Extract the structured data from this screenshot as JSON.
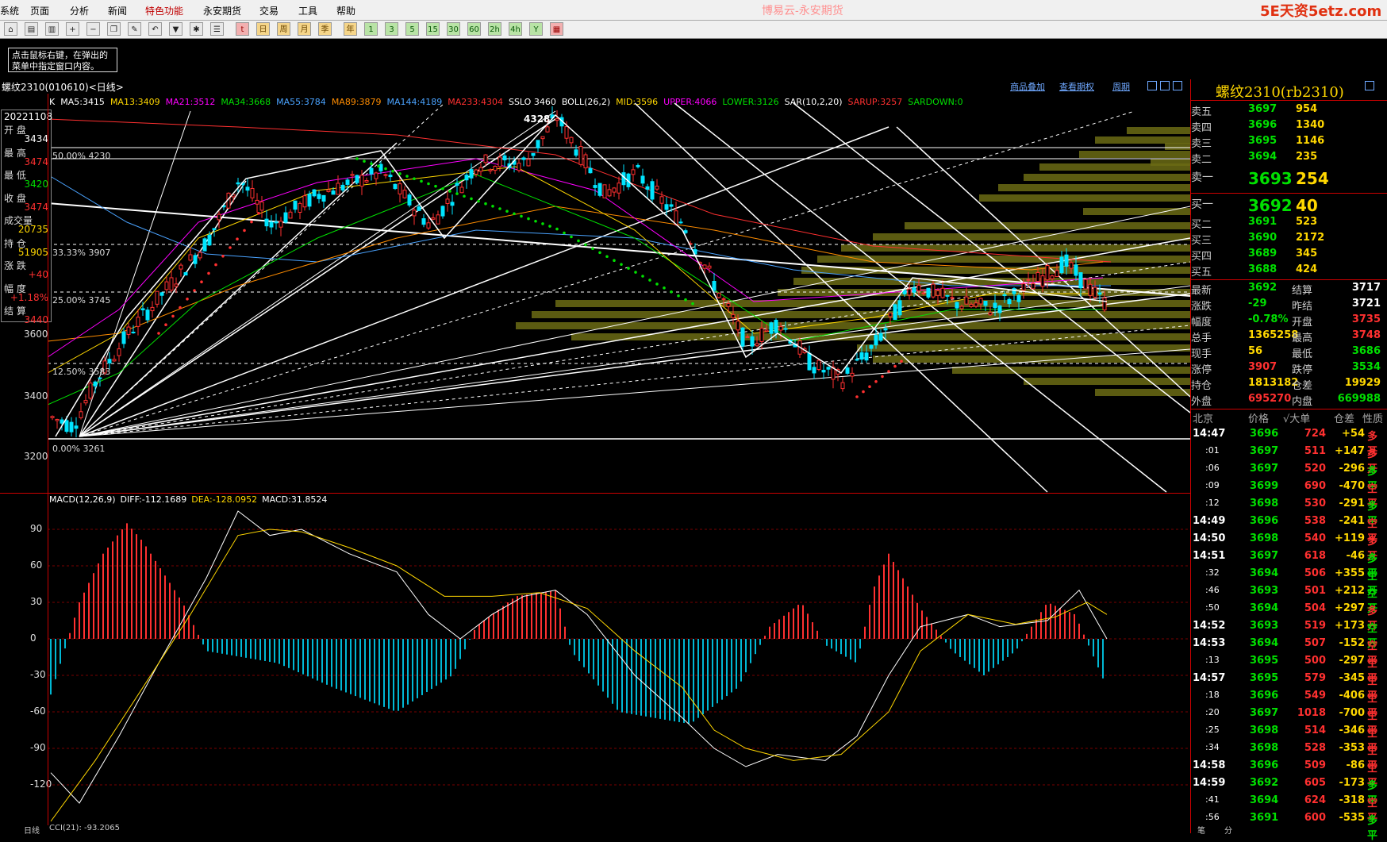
{
  "menu": {
    "items": [
      "系统",
      "页面",
      "分析",
      "新闻",
      "特色功能",
      "永安期货",
      "交易",
      "工具",
      "帮助"
    ],
    "active_index": 4,
    "app_title": "博易云-永安期货",
    "watermark": "5E天资5etz.com"
  },
  "toolbar": {
    "buttons": [
      "home",
      "news",
      "chart",
      "zoom-in",
      "zoom-out",
      "copy",
      "draw",
      "undo",
      "filter",
      "new",
      "list",
      "tick",
      "day",
      "week",
      "month",
      "season",
      "year",
      "1",
      "3",
      "5",
      "15",
      "30",
      "60",
      "2h",
      "4h",
      "Y",
      "table"
    ]
  },
  "hint": {
    "line1": "点击鼠标右键，在弹出的",
    "line2": "菜单中指定窗口内容。"
  },
  "chart_header": {
    "title": "螺纹2310(010610)<日线>",
    "links": [
      "商品叠加",
      "查看期权",
      "周期"
    ]
  },
  "indicators": [
    {
      "text": "K",
      "color": "#ffffff"
    },
    {
      "text": "MA5:3415",
      "color": "#ffffff"
    },
    {
      "text": "MA13:3409",
      "color": "#ffd700"
    },
    {
      "text": "MA21:3512",
      "color": "#ff00ff"
    },
    {
      "text": "MA34:3668",
      "color": "#00e000"
    },
    {
      "text": "MA55:3784",
      "color": "#4aa3ff"
    },
    {
      "text": "MA89:3879",
      "color": "#ff8c00"
    },
    {
      "text": "MA144:4189",
      "color": "#4aa3ff"
    },
    {
      "text": "MA233:4304",
      "color": "#ff3030"
    },
    {
      "text": "SSLO 3460",
      "color": "#ffffff"
    },
    {
      "text": "BOLL(26,2)",
      "color": "#ffffff"
    },
    {
      "text": "MID:3596",
      "color": "#ffd700"
    },
    {
      "text": "UPPER:4066",
      "color": "#ff00ff"
    },
    {
      "text": "LOWER:3126",
      "color": "#00e000"
    },
    {
      "text": "SAR(10,2,20)",
      "color": "#ffffff"
    },
    {
      "text": "SARUP:3257",
      "color": "#ff3030"
    },
    {
      "text": "SARDOWN:0",
      "color": "#00e000"
    }
  ],
  "ohlc_box": {
    "date": "20221108",
    "rows": [
      {
        "label": "开  盘",
        "value": "3434",
        "color": "#ffffff"
      },
      {
        "label": "最  高",
        "value": "3474",
        "color": "#ff3030"
      },
      {
        "label": "最  低",
        "value": "3420",
        "color": "#00e000"
      },
      {
        "label": "收  盘",
        "value": "3474",
        "color": "#ff3030"
      },
      {
        "label": "成交量",
        "value": "20735",
        "color": "#ffd700"
      },
      {
        "label": "持  仓",
        "value": "51905",
        "color": "#ffd700"
      },
      {
        "label": "涨  跌",
        "value": "+40",
        "color": "#ff3030"
      },
      {
        "label": "幅  度",
        "value": "+1.18%",
        "color": "#ff3030"
      },
      {
        "label": "结  算",
        "value": "3440",
        "color": "#ff3030"
      }
    ]
  },
  "price_axis": [
    "3600",
    "3400",
    "3200"
  ],
  "fib_labels": [
    {
      "text": "50.00% 4230"
    },
    {
      "text": "33.33% 3907"
    },
    {
      "text": "25.00% 3745"
    },
    {
      "text": "12.50% 3583"
    },
    {
      "text": "0.00% 3261"
    }
  ],
  "high_marker": "4328",
  "macd": {
    "header": [
      {
        "text": "MACD(12,26,9)",
        "color": "#ffffff"
      },
      {
        "text": "DIFF:-112.1689",
        "color": "#ffffff"
      },
      {
        "text": "DEA:-128.0952",
        "color": "#ffd700"
      },
      {
        "text": "MACD:31.8524",
        "color": "#ffffff"
      }
    ],
    "axis": [
      "90",
      "60",
      "30",
      "0",
      "-30",
      "-60",
      "-90",
      "-120"
    ]
  },
  "footer": {
    "left": "日线",
    "cci": "CCI(21): -93.2065"
  },
  "quote": {
    "title": "螺纹2310(rb2310)",
    "asks": [
      {
        "label": "卖五",
        "price": "3697",
        "vol": "954"
      },
      {
        "label": "卖四",
        "price": "3696",
        "vol": "1340"
      },
      {
        "label": "卖三",
        "price": "3695",
        "vol": "1146"
      },
      {
        "label": "卖二",
        "price": "3694",
        "vol": "235"
      },
      {
        "label": "卖一",
        "price": "3693",
        "vol": "254"
      }
    ],
    "bids": [
      {
        "label": "买一",
        "price": "3692",
        "vol": "40"
      },
      {
        "label": "买二",
        "price": "3691",
        "vol": "523"
      },
      {
        "label": "买三",
        "price": "3690",
        "vol": "2172"
      },
      {
        "label": "买四",
        "price": "3689",
        "vol": "345"
      },
      {
        "label": "买五",
        "price": "3688",
        "vol": "424"
      }
    ],
    "stats": [
      {
        "k1": "最新",
        "v1": "3692",
        "c1": "#00e000",
        "k2": "结算",
        "v2": "3717",
        "c2": "#ffffff"
      },
      {
        "k1": "涨跌",
        "v1": "-29",
        "c1": "#00e000",
        "k2": "昨结",
        "v2": "3721",
        "c2": "#ffffff"
      },
      {
        "k1": "幅度",
        "v1": "-0.78%",
        "c1": "#00e000",
        "k2": "开盘",
        "v2": "3735",
        "c2": "#ff3030"
      },
      {
        "k1": "总手",
        "v1": "1365258",
        "c1": "#ffd700",
        "k2": "最高",
        "v2": "3748",
        "c2": "#ff3030"
      },
      {
        "k1": "现手",
        "v1": "56",
        "c1": "#ffd700",
        "k2": "最低",
        "v2": "3686",
        "c2": "#00e000"
      },
      {
        "k1": "涨停",
        "v1": "3907",
        "c1": "#ff3030",
        "k2": "跌停",
        "v2": "3534",
        "c2": "#00e000"
      },
      {
        "k1": "持仓",
        "v1": "1813182",
        "c1": "#ffd700",
        "k2": "仓差",
        "v2": "19929",
        "c2": "#ffd700"
      },
      {
        "k1": "外盘",
        "v1": "695270",
        "c1": "#ff3030",
        "k2": "内盘",
        "v2": "669988",
        "c2": "#00e000"
      }
    ],
    "tick_header": [
      "北京",
      "价格",
      "√大单",
      "仓差",
      "性质"
    ],
    "ticks": [
      {
        "t": "14:47",
        "p": "3696",
        "v": "724",
        "oi": "+54",
        "ty": "多开",
        "oic": "#ffd700",
        "tyc": "#ff3030"
      },
      {
        "t": ":01",
        "p": "3697",
        "v": "511",
        "oi": "+147",
        "ty": "多开",
        "oic": "#ffd700",
        "tyc": "#ff3030"
      },
      {
        "t": ":06",
        "p": "3697",
        "v": "520",
        "oi": "-296",
        "ty": "多平",
        "oic": "#ffd700",
        "tyc": "#00e000"
      },
      {
        "t": ":09",
        "p": "3699",
        "v": "690",
        "oi": "-470",
        "ty": "空平",
        "oic": "#ffd700",
        "tyc": "#ff3030"
      },
      {
        "t": ":12",
        "p": "3698",
        "v": "530",
        "oi": "-291",
        "ty": "多平",
        "oic": "#ffd700",
        "tyc": "#00e000"
      },
      {
        "t": "14:49",
        "p": "3696",
        "v": "538",
        "oi": "-241",
        "ty": "空平",
        "oic": "#ffd700",
        "tyc": "#ff3030"
      },
      {
        "t": "14:50",
        "p": "3698",
        "v": "540",
        "oi": "+119",
        "ty": "多开",
        "oic": "#ffd700",
        "tyc": "#ff3030"
      },
      {
        "t": "14:51",
        "p": "3697",
        "v": "618",
        "oi": "-46",
        "ty": "多平",
        "oic": "#ffd700",
        "tyc": "#00e000"
      },
      {
        "t": ":32",
        "p": "3694",
        "v": "506",
        "oi": "+355",
        "ty": "空开",
        "oic": "#ffd700",
        "tyc": "#00e000"
      },
      {
        "t": ":46",
        "p": "3693",
        "v": "501",
        "oi": "+212",
        "ty": "空开",
        "oic": "#ffd700",
        "tyc": "#00e000"
      },
      {
        "t": ":50",
        "p": "3694",
        "v": "504",
        "oi": "+297",
        "ty": "多开",
        "oic": "#ffd700",
        "tyc": "#ff3030"
      },
      {
        "t": "14:52",
        "p": "3693",
        "v": "519",
        "oi": "+173",
        "ty": "空开",
        "oic": "#ffd700",
        "tyc": "#00e000"
      },
      {
        "t": "14:53",
        "p": "3694",
        "v": "507",
        "oi": "-152",
        "ty": "空平",
        "oic": "#ffd700",
        "tyc": "#ff3030"
      },
      {
        "t": ":13",
        "p": "3695",
        "v": "500",
        "oi": "-297",
        "ty": "空平",
        "oic": "#ffd700",
        "tyc": "#ff3030"
      },
      {
        "t": "14:57",
        "p": "3695",
        "v": "579",
        "oi": "-345",
        "ty": "空平",
        "oic": "#ffd700",
        "tyc": "#ff3030"
      },
      {
        "t": ":18",
        "p": "3696",
        "v": "549",
        "oi": "-406",
        "ty": "空平",
        "oic": "#ffd700",
        "tyc": "#ff3030"
      },
      {
        "t": ":20",
        "p": "3697",
        "v": "1018",
        "oi": "-700",
        "ty": "空平",
        "oic": "#ffd700",
        "tyc": "#ff3030"
      },
      {
        "t": ":25",
        "p": "3698",
        "v": "514",
        "oi": "-346",
        "ty": "空平",
        "oic": "#ffd700",
        "tyc": "#ff3030"
      },
      {
        "t": ":34",
        "p": "3698",
        "v": "528",
        "oi": "-353",
        "ty": "空平",
        "oic": "#ffd700",
        "tyc": "#ff3030"
      },
      {
        "t": "14:58",
        "p": "3696",
        "v": "509",
        "oi": "-86",
        "ty": "空平",
        "oic": "#ffd700",
        "tyc": "#ff3030"
      },
      {
        "t": "14:59",
        "p": "3692",
        "v": "605",
        "oi": "-173",
        "ty": "多平",
        "oic": "#ffd700",
        "tyc": "#00e000"
      },
      {
        "t": ":41",
        "p": "3694",
        "v": "624",
        "oi": "-318",
        "ty": "空平",
        "oic": "#ffd700",
        "tyc": "#ff3030"
      },
      {
        "t": ":56",
        "p": "3691",
        "v": "600",
        "oi": "-535",
        "ty": "多平",
        "oic": "#ffd700",
        "tyc": "#00e000"
      }
    ],
    "footer": [
      "笔",
      "分"
    ]
  }
}
